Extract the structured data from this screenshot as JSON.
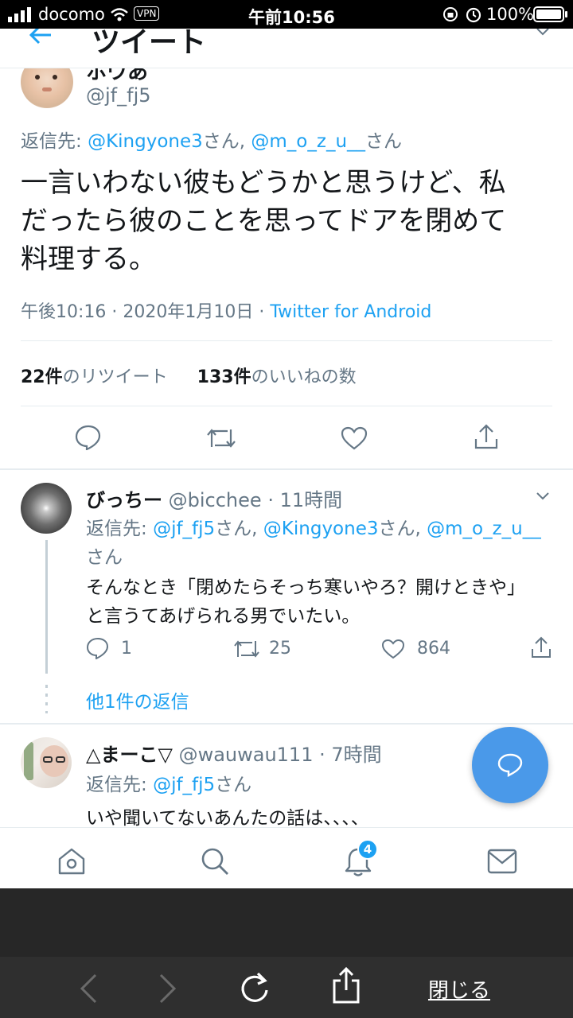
{
  "status_bar": {
    "carrier": "docomo",
    "vpn": "VPN",
    "time": "午前10:56",
    "battery": "100%"
  },
  "header": {
    "title": "ツイート"
  },
  "main_tweet": {
    "display_name": "ホウあ",
    "handle": "@jf_fj5",
    "reply_prefix": "返信先:",
    "reply_to_1": "@Kingyone3",
    "reply_suffix_1": "さん,",
    "reply_to_2": "@m_o_z_u__",
    "reply_suffix_2": "さん",
    "text_lines": [
      "一言いわない彼もどうかと思うけど、私",
      "だったら彼のことを思ってドアを閉めて",
      "料理する。"
    ],
    "timestamp": "午後10:16 · 2020年1月10日 · ",
    "source": "Twitter for Android",
    "retweet_count": "22件",
    "retweet_label": "のリツイート",
    "like_count": "133件",
    "like_label": "のいいねの数"
  },
  "reply_1": {
    "display_name": "びっちー",
    "handle": "@bicchee",
    "time": "· 11時間",
    "reply_prefix": "返信先:",
    "reply_to_1": "@jf_fj5",
    "reply_suffix_1": "さん,",
    "reply_to_2": "@Kingyone3",
    "reply_suffix_2": "さん,",
    "reply_to_3": "@m_o_z_u__",
    "reply_suffix_3": "さん",
    "text_lines": [
      "そんなとき「閉めたらそっち寒いやろ？開けときや」",
      "と言うてあげられる男でいたい。"
    ],
    "reply_count": "1",
    "retweet_count": "25",
    "like_count": "864",
    "more_replies": "他1件の返信"
  },
  "reply_2": {
    "display_name": "△まーこ▽",
    "handle": "@wauwau111",
    "time": "· 7時間",
    "reply_prefix": "返信先:",
    "reply_to_1": "@jf_fj5",
    "reply_suffix_1": "さん",
    "text": "いや聞いてないあんたの話は、、、、"
  },
  "tab_bar": {
    "notification_badge": "4"
  },
  "safari_bar": {
    "close_label": "閉じる"
  }
}
